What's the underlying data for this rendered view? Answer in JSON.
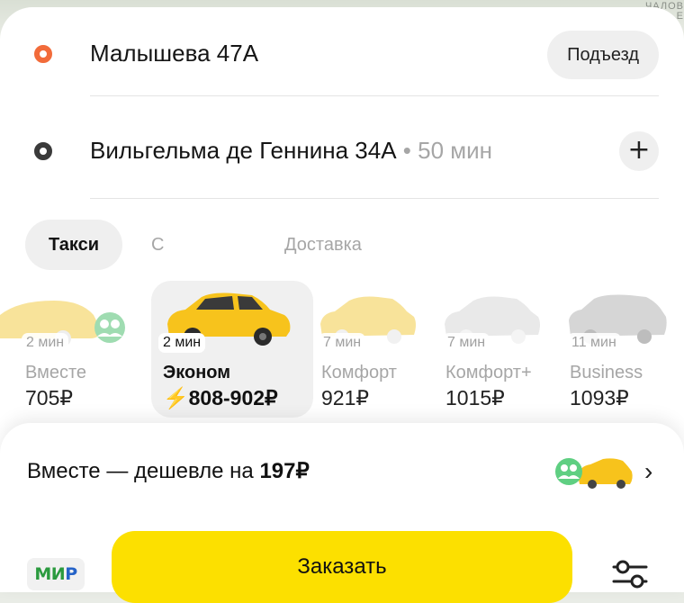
{
  "map": {
    "label": "ЧАЛОВ\nЕ"
  },
  "route": {
    "from": {
      "address": "Малышева 47А",
      "entrance_button": "Подъезд"
    },
    "to": {
      "address": "Вильгельма де Геннина 34А",
      "eta": " • 50 мин",
      "add_button": "+"
    }
  },
  "tabs": [
    {
      "label": "Такси",
      "active": true
    },
    {
      "label": "С детьми",
      "active": false
    },
    {
      "label": "Доставка",
      "active": false
    }
  ],
  "tariffs": [
    {
      "time": "2 мин",
      "name": "Вместе",
      "price": "705₽",
      "selected": false,
      "car_color": "#f8e39a"
    },
    {
      "time": "2 мин",
      "name": "Эконом",
      "price": "808-902₽",
      "price_icon": "⚡",
      "selected": true,
      "car_color": "#f7c31c"
    },
    {
      "time": "7 мин",
      "name": "Комфорт",
      "price": "921₽",
      "selected": false,
      "car_color": "#f8e39a"
    },
    {
      "time": "7 мин",
      "name": "Комфорт+",
      "price": "1015₽",
      "selected": false,
      "car_color": "#e9e9e9"
    },
    {
      "time": "11 мин",
      "name": "Business",
      "price": "1093₽",
      "selected": false,
      "car_color": "#d6d6d6"
    }
  ],
  "promo": {
    "text": "Вместе — дешевле на ",
    "amount": "197₽"
  },
  "payment": {
    "method_label": "МИ",
    "method_label_tail": "Р"
  },
  "order_button": "Заказать",
  "colors": {
    "accent": "#fce000",
    "origin_dot": "#f26b3a",
    "surge": "#ff3b30",
    "together_badge": "#5fcf82"
  }
}
